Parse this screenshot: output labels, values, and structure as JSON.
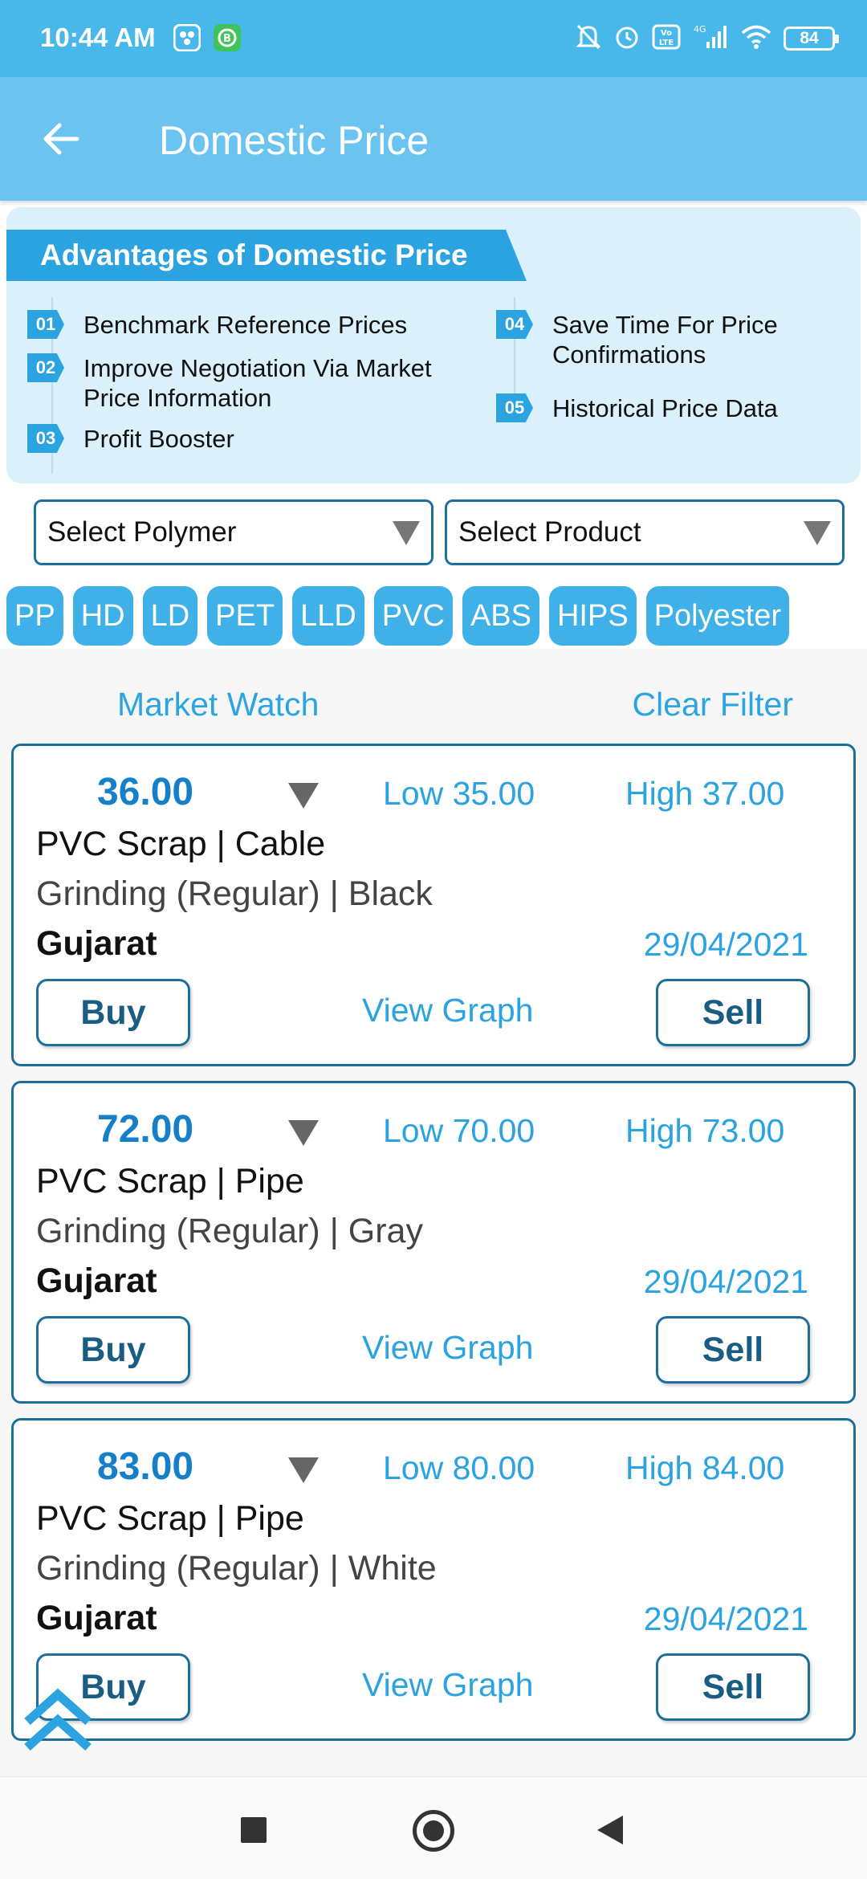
{
  "status_bar": {
    "time": "10:44 AM",
    "battery": "84",
    "network": "4G",
    "volte": "Vo LTE",
    "icons": [
      "app-notification-icon",
      "whatsapp-business-icon",
      "mute-bell-icon",
      "alarm-icon",
      "volte-icon",
      "signal-icon",
      "wifi-icon",
      "battery-icon"
    ]
  },
  "app_bar": {
    "title": "Domestic Price",
    "back_icon": "arrow-left-icon"
  },
  "advantages": {
    "title": "Advantages of Domestic Price",
    "items": [
      {
        "num": "01",
        "text": "Benchmark Reference Prices"
      },
      {
        "num": "02",
        "text": "Improve Negotiation Via Market Price Information"
      },
      {
        "num": "03",
        "text": "Profit Booster"
      },
      {
        "num": "04",
        "text": "Save Time For Price Confirmations"
      },
      {
        "num": "05",
        "text": "Historical Price Data"
      }
    ]
  },
  "filters": {
    "polymer_select": "Select Polymer",
    "product_select": "Select Product",
    "chips": [
      "PP",
      "HD",
      "LD",
      "PET",
      "LLD",
      "PVC",
      "ABS",
      "HIPS",
      "Polyester"
    ]
  },
  "market_watch": {
    "label": "Market Watch",
    "clear_filter": "Clear Filter",
    "cards": [
      {
        "price": "36.00",
        "low": "Low 35.00",
        "high": "High 37.00",
        "name": "PVC Scrap | Cable",
        "detail": "Grinding (Regular) | Black",
        "state": "Gujarat",
        "date": "29/04/2021",
        "buy": "Buy",
        "view_graph": "View Graph",
        "sell": "Sell"
      },
      {
        "price": "72.00",
        "low": "Low 70.00",
        "high": "High 73.00",
        "name": "PVC Scrap | Pipe",
        "detail": "Grinding (Regular) | Gray",
        "state": "Gujarat",
        "date": "29/04/2021",
        "buy": "Buy",
        "view_graph": "View Graph",
        "sell": "Sell"
      },
      {
        "price": "83.00",
        "low": "Low 80.00",
        "high": "High 84.00",
        "name": "PVC Scrap | Pipe",
        "detail": "Grinding (Regular) | White",
        "state": "Gujarat",
        "date": "29/04/2021",
        "buy": "Buy",
        "view_graph": "View Graph",
        "sell": "Sell"
      }
    ]
  },
  "colors": {
    "status_bar": "#48b7ea",
    "app_bar": "#6ac4ef",
    "accent": "#2aa3e0",
    "price": "#1580c9",
    "border": "#1d6f9b"
  }
}
